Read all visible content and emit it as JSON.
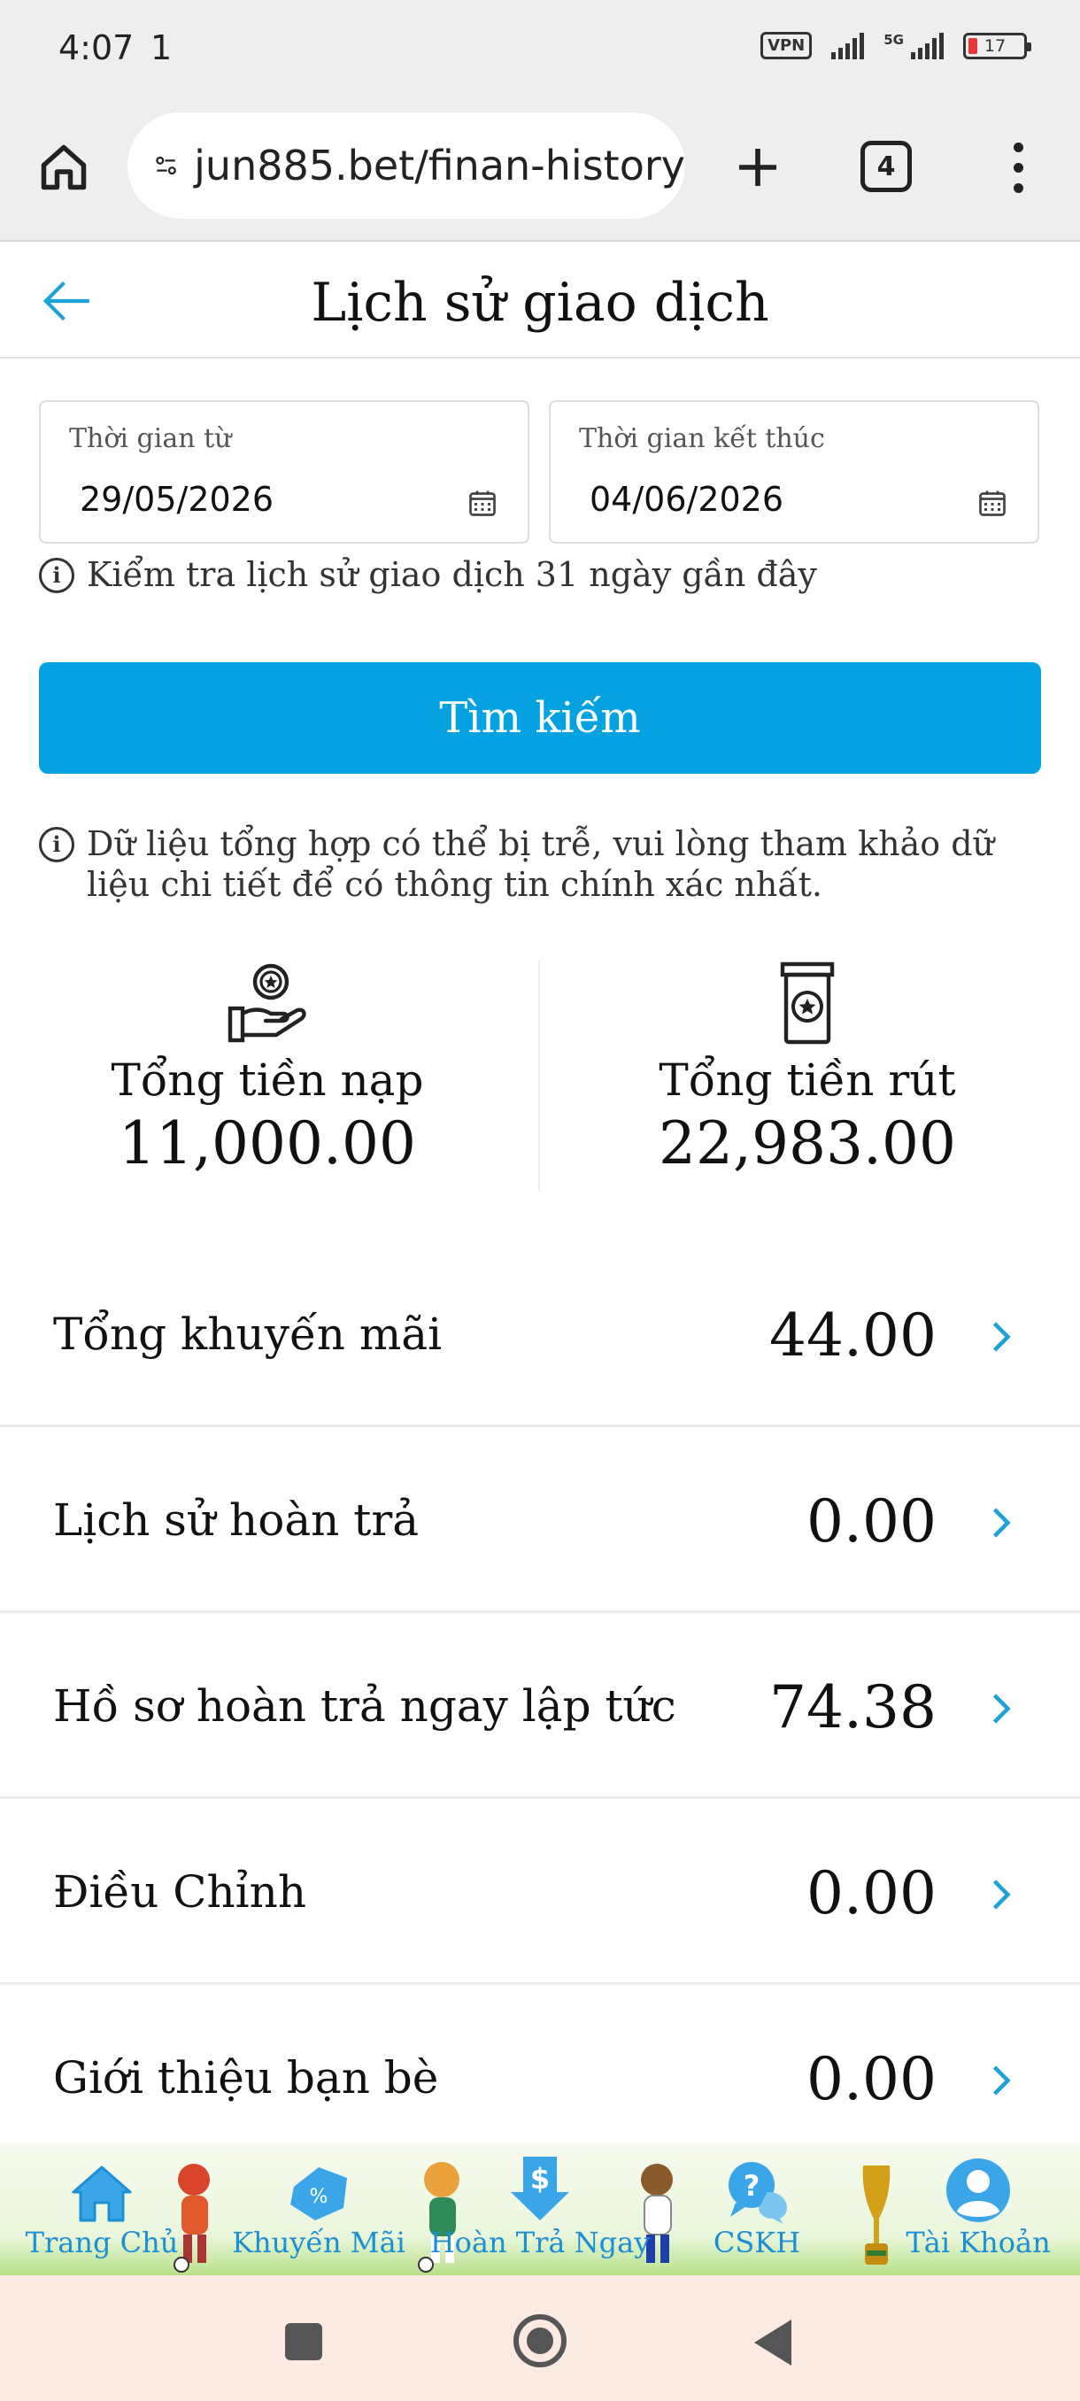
{
  "status_bar": {
    "time": "4:07",
    "extra": "1",
    "vpn": "VPN",
    "network": "5G",
    "battery": "17"
  },
  "browser": {
    "url": "jun885.bet/finan-history",
    "tab_count": "4"
  },
  "header": {
    "title": "Lịch sử giao dịch"
  },
  "filters": {
    "from_label": "Thời gian từ",
    "from_value": "29/05/2026",
    "to_label": "Thời gian kết thúc",
    "to_value": "04/06/2026",
    "hint": "Kiểm tra lịch sử giao dịch 31 ngày gần đây",
    "search_label": "Tìm kiếm"
  },
  "notice": "Dữ liệu tổng hợp có thể bị trễ, vui lòng tham khảo dữ liệu chi tiết để có thông tin chính xác nhất.",
  "totals": {
    "deposit_label": "Tổng tiền nạp",
    "deposit_value": "11,000.00",
    "withdraw_label": "Tổng tiền rút",
    "withdraw_value": "22,983.00"
  },
  "rows": [
    {
      "label": "Tổng khuyến mãi",
      "value": "44.00"
    },
    {
      "label": "Lịch sử hoàn trả",
      "value": "0.00"
    },
    {
      "label": "Hồ sơ hoàn trả ngay lập tức",
      "value": "74.38"
    },
    {
      "label": "Điều Chỉnh",
      "value": "0.00"
    },
    {
      "label": "Giới thiệu bạn bè",
      "value": "0.00"
    }
  ],
  "bottom_nav": [
    {
      "label": "Trang Chủ",
      "icon": "home-icon"
    },
    {
      "label": "Khuyến Mãi",
      "icon": "promo-tag-icon"
    },
    {
      "label": "Hoàn Trả Ngay",
      "icon": "dollar-download-icon"
    },
    {
      "label": "CSKH",
      "icon": "help-chat-icon"
    },
    {
      "label": "Tài Khoản",
      "icon": "account-icon"
    }
  ],
  "colors": {
    "accent": "#05a2e2",
    "nav_label": "#1b8fd6",
    "text": "#111111"
  }
}
